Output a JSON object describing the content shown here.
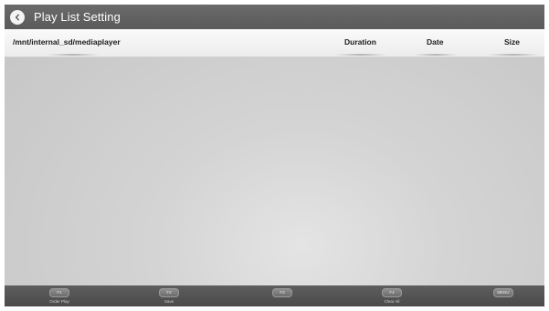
{
  "window": {
    "title": "Play List Setting"
  },
  "table": {
    "columns": {
      "path": "/mnt/internal_sd/mediaplayer",
      "duration": "Duration",
      "date": "Date",
      "size": "Size"
    },
    "rows": []
  },
  "footer": {
    "keys": [
      {
        "key": "F1",
        "label": "Order Play"
      },
      {
        "key": "F2",
        "label": "Save"
      },
      {
        "key": "F3",
        "label": ""
      },
      {
        "key": "F4",
        "label": "Clear All"
      },
      {
        "key": "MENU",
        "label": ""
      }
    ]
  },
  "icons": {
    "back": "chevron-left-icon"
  },
  "colors": {
    "titlebar": "#5f5f5f",
    "footer": "#525252",
    "header": "#f2f2f2",
    "content": "#cccccc"
  }
}
